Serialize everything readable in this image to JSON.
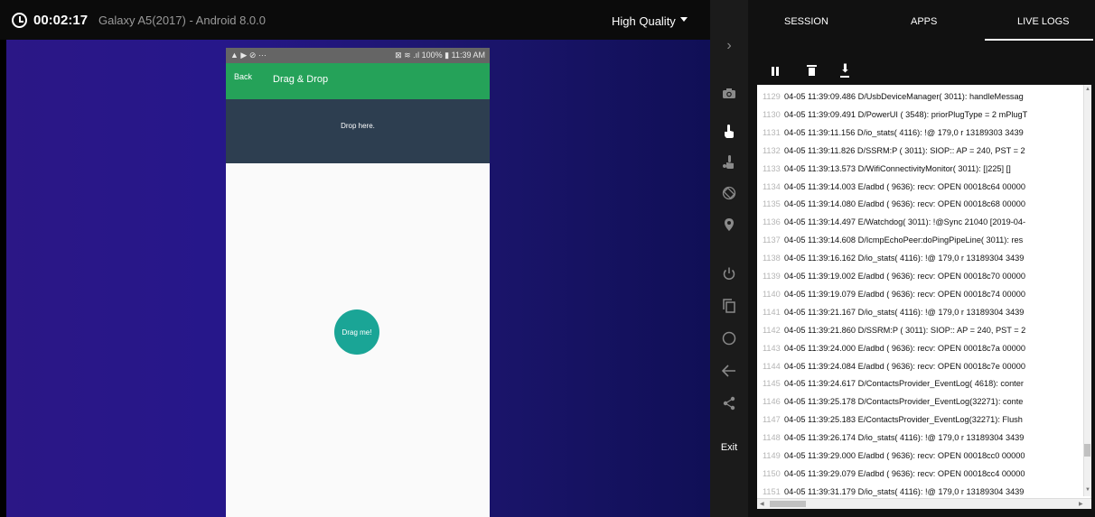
{
  "header": {
    "timer": "00:02:17",
    "device": "Galaxy A5(2017) - Android 8.0.0",
    "quality": "High Quality"
  },
  "phone": {
    "status_left": "▲ ▶ ⊘ ···",
    "status_right": "⊠ ≋ .ıl 100% ▮ 11:39 AM",
    "back": "Back",
    "title": "Drag & Drop",
    "drop_text": "Drop here.",
    "drag_text": "Drag me!"
  },
  "toolbar": {
    "expand_icon": "›",
    "exit": "Exit"
  },
  "panel": {
    "tabs": [
      "SESSION",
      "APPS",
      "LIVE LOGS"
    ],
    "active_tab": "LIVE LOGS",
    "logs": [
      {
        "n": "1129",
        "t": "04-05 11:39:09.486 D/UsbDeviceManager( 3011): handleMessag"
      },
      {
        "n": "1130",
        "t": "04-05 11:39:09.491 D/PowerUI ( 3548): priorPlugType = 2 mPlugT"
      },
      {
        "n": "1131",
        "t": "04-05 11:39:11.156 D/io_stats( 4116): !@ 179,0 r 13189303 3439"
      },
      {
        "n": "1132",
        "t": "04-05 11:39:11.826 D/SSRM:P ( 3011): SIOP:: AP = 240, PST = 2"
      },
      {
        "n": "1133",
        "t": "04-05 11:39:13.573 D/WifiConnectivityMonitor( 3011): [|225] []"
      },
      {
        "n": "1134",
        "t": "04-05 11:39:14.003 E/adbd ( 9636): recv: OPEN 00018c64 00000"
      },
      {
        "n": "1135",
        "t": "04-05 11:39:14.080 E/adbd ( 9636): recv: OPEN 00018c68 00000"
      },
      {
        "n": "1136",
        "t": "04-05 11:39:14.497 E/Watchdog( 3011): !@Sync 21040 [2019-04-"
      },
      {
        "n": "1137",
        "t": "04-05 11:39:14.608 D/IcmpEchoPeer:doPingPipeLine( 3011): res"
      },
      {
        "n": "1138",
        "t": "04-05 11:39:16.162 D/io_stats( 4116): !@ 179,0 r 13189304 3439"
      },
      {
        "n": "1139",
        "t": "04-05 11:39:19.002 E/adbd ( 9636): recv: OPEN 00018c70 00000"
      },
      {
        "n": "1140",
        "t": "04-05 11:39:19.079 E/adbd ( 9636): recv: OPEN 00018c74 00000"
      },
      {
        "n": "1141",
        "t": "04-05 11:39:21.167 D/io_stats( 4116): !@ 179,0 r 13189304 3439"
      },
      {
        "n": "1142",
        "t": "04-05 11:39:21.860 D/SSRM:P ( 3011): SIOP:: AP = 240, PST = 2"
      },
      {
        "n": "1143",
        "t": "04-05 11:39:24.000 E/adbd ( 9636): recv: OPEN 00018c7a 00000"
      },
      {
        "n": "1144",
        "t": "04-05 11:39:24.084 E/adbd ( 9636): recv: OPEN 00018c7e 00000"
      },
      {
        "n": "1145",
        "t": "04-05 11:39:24.617 D/ContactsProvider_EventLog( 4618): conter"
      },
      {
        "n": "1146",
        "t": "04-05 11:39:25.178 D/ContactsProvider_EventLog(32271): conte"
      },
      {
        "n": "1147",
        "t": "04-05 11:39:25.183 E/ContactsProvider_EventLog(32271): Flush"
      },
      {
        "n": "1148",
        "t": "04-05 11:39:26.174 D/io_stats( 4116): !@ 179,0 r 13189304 3439"
      },
      {
        "n": "1149",
        "t": "04-05 11:39:29.000 E/adbd ( 9636): recv: OPEN 00018cc0 00000"
      },
      {
        "n": "1150",
        "t": "04-05 11:39:29.079 E/adbd ( 9636): recv: OPEN 00018cc4 00000"
      },
      {
        "n": "1151",
        "t": "04-05 11:39:31.179 D/io_stats( 4116): !@ 179,0 r 13189304 3439"
      }
    ]
  }
}
